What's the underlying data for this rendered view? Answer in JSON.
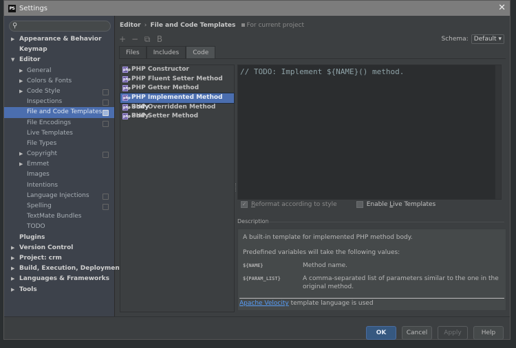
{
  "window": {
    "title": "Settings",
    "logo": "PS"
  },
  "sidebar": {
    "search": {
      "placeholder": "",
      "value": ""
    },
    "items": [
      {
        "label": "Appearance & Behavior",
        "level": 0,
        "arrow": "collapsed",
        "project": false
      },
      {
        "label": "Keymap",
        "level": 0,
        "arrow": "none",
        "project": false
      },
      {
        "label": "Editor",
        "level": 0,
        "arrow": "expanded",
        "project": false
      },
      {
        "label": "General",
        "level": 1,
        "arrow": "collapsed",
        "project": false
      },
      {
        "label": "Colors & Fonts",
        "level": 1,
        "arrow": "collapsed",
        "project": false
      },
      {
        "label": "Code Style",
        "level": 1,
        "arrow": "collapsed",
        "project": true
      },
      {
        "label": "Inspections",
        "level": 1,
        "arrow": "none",
        "project": true
      },
      {
        "label": "File and Code Templates",
        "level": 1,
        "arrow": "none",
        "project": true,
        "selected": true
      },
      {
        "label": "File Encodings",
        "level": 1,
        "arrow": "none",
        "project": true
      },
      {
        "label": "Live Templates",
        "level": 1,
        "arrow": "none",
        "project": false
      },
      {
        "label": "File Types",
        "level": 1,
        "arrow": "none",
        "project": false
      },
      {
        "label": "Copyright",
        "level": 1,
        "arrow": "collapsed",
        "project": true
      },
      {
        "label": "Emmet",
        "level": 1,
        "arrow": "collapsed",
        "project": false
      },
      {
        "label": "Images",
        "level": 1,
        "arrow": "none",
        "project": false
      },
      {
        "label": "Intentions",
        "level": 1,
        "arrow": "none",
        "project": false
      },
      {
        "label": "Language Injections",
        "level": 1,
        "arrow": "none",
        "project": true
      },
      {
        "label": "Spelling",
        "level": 1,
        "arrow": "none",
        "project": true
      },
      {
        "label": "TextMate Bundles",
        "level": 1,
        "arrow": "none",
        "project": false
      },
      {
        "label": "TODO",
        "level": 1,
        "arrow": "none",
        "project": false
      },
      {
        "label": "Plugins",
        "level": 0,
        "arrow": "none",
        "project": false
      },
      {
        "label": "Version Control",
        "level": 0,
        "arrow": "collapsed",
        "project": false
      },
      {
        "label": "Project: crm",
        "level": 0,
        "arrow": "collapsed",
        "project": false
      },
      {
        "label": "Build, Execution, Deployment",
        "level": 0,
        "arrow": "collapsed",
        "project": false
      },
      {
        "label": "Languages & Frameworks",
        "level": 0,
        "arrow": "collapsed",
        "project": false
      },
      {
        "label": "Tools",
        "level": 0,
        "arrow": "collapsed",
        "project": false
      }
    ]
  },
  "header": {
    "breadcrumb": [
      "Editor",
      "File and Code Templates"
    ],
    "breadcrumb_sep": "›",
    "scope_note": "For current project",
    "schema_label": "Schema:",
    "schema_value": "Default"
  },
  "toolbar": {
    "add": "+",
    "remove": "−",
    "copy": "⧉",
    "reset": "B"
  },
  "tabs": [
    {
      "label": "Files",
      "active": false
    },
    {
      "label": "Includes",
      "active": false
    },
    {
      "label": "Code",
      "active": true
    }
  ],
  "templates": [
    {
      "label": "PHP Constructor"
    },
    {
      "label": "PHP Fluent Setter Method"
    },
    {
      "label": "PHP Getter Method"
    },
    {
      "label": "PHP Implemented Method Body",
      "selected": true
    },
    {
      "label": "PHP Overridden Method Body"
    },
    {
      "label": "PHP Setter Method"
    }
  ],
  "editor": {
    "content": "// TODO: Implement ${NAME}() method."
  },
  "options": {
    "reformat": {
      "label_prefix": "",
      "mnemonic": "R",
      "label_rest": "eformat according to style",
      "checked": true,
      "disabled": true
    },
    "live_templates": {
      "label_prefix": "Enable ",
      "mnemonic": "L",
      "label_rest": "ive Templates",
      "checked": false,
      "disabled": false
    }
  },
  "description": {
    "label": "Description",
    "intro": "A built-in template for implemented PHP method body.",
    "vars_intro": "Predefined variables will take the following values:",
    "variables": [
      {
        "name": "${NAME}",
        "desc": "Method name."
      },
      {
        "name": "${PARAM_LIST}",
        "desc": "A comma-separated list of parameters similar to the one in the original method."
      }
    ],
    "footer_link": "Apache Velocity",
    "footer_text": " template language is used"
  },
  "buttons": {
    "ok": "OK",
    "cancel": "Cancel",
    "apply": "Apply",
    "help": "Help"
  },
  "colors": {
    "selection": "#4b6eaf",
    "primary_button": "#365880",
    "link": "#589df6"
  }
}
